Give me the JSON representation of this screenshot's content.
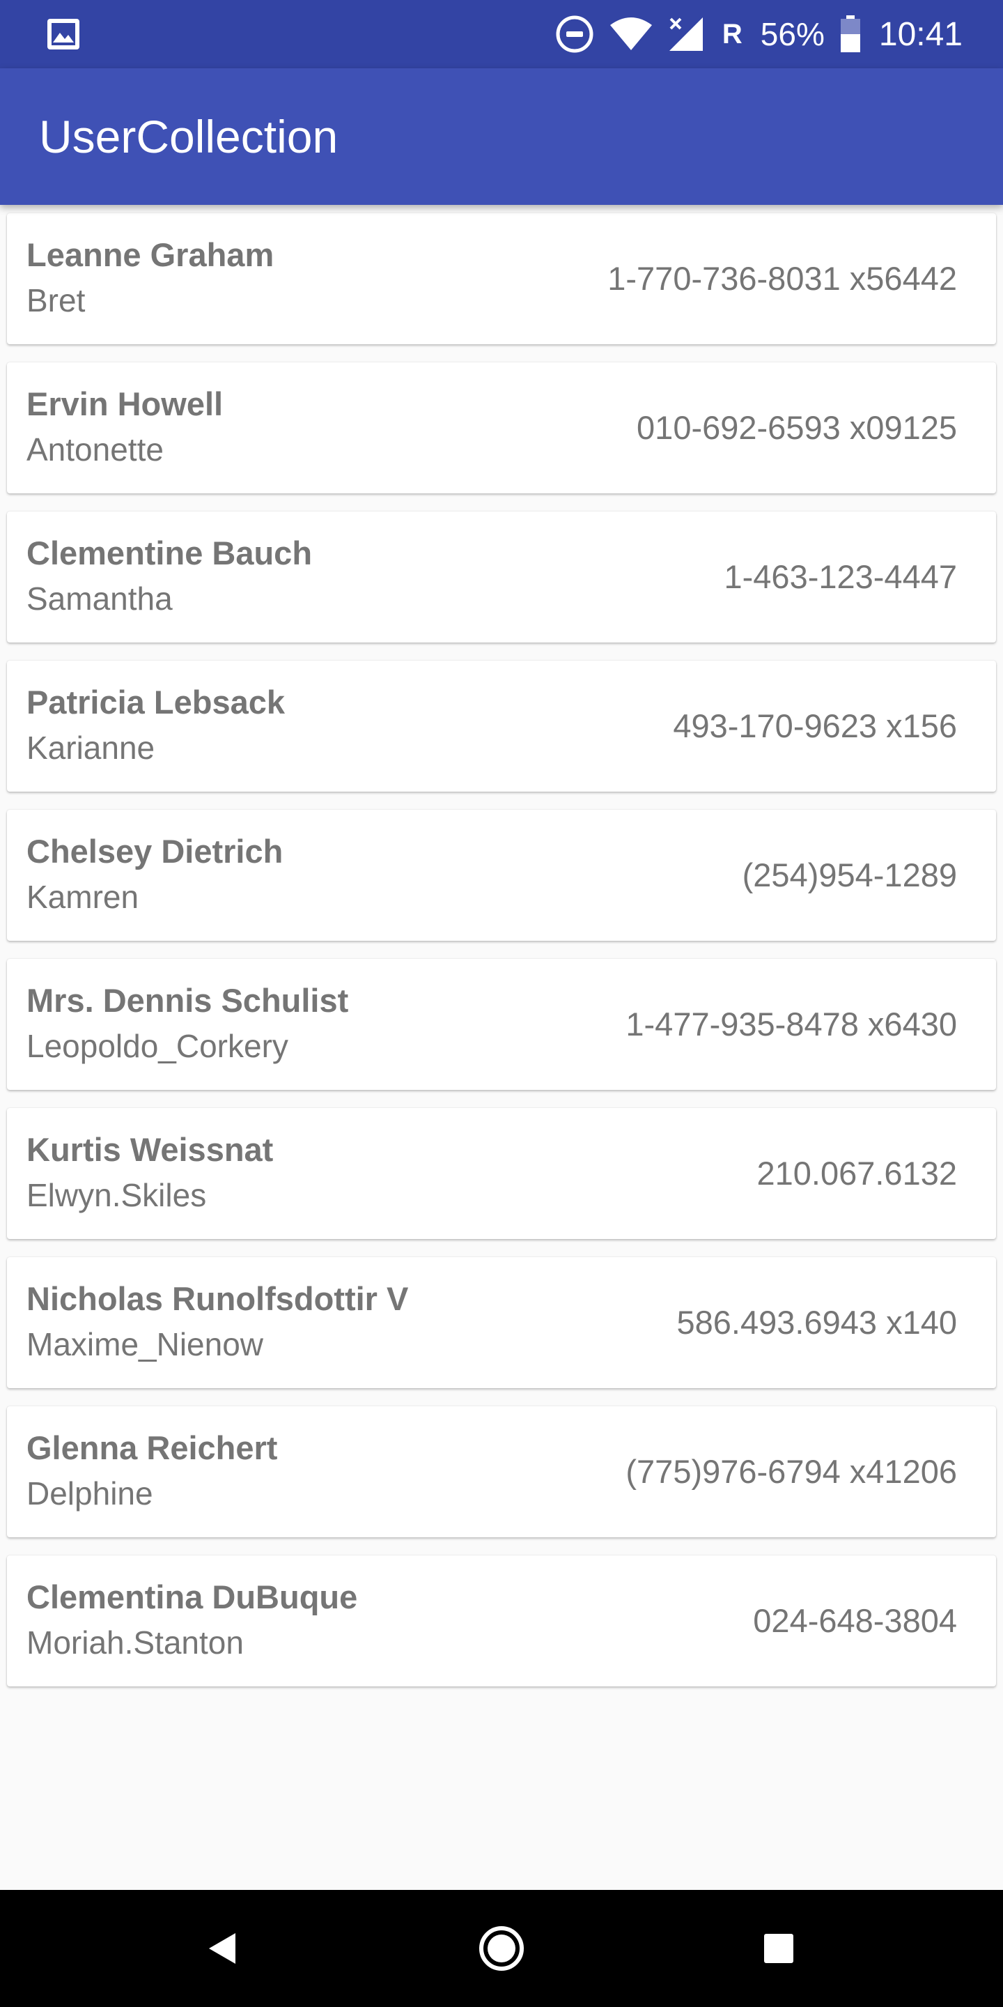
{
  "status_bar": {
    "left_icon": "image-icon",
    "icons": [
      "do-not-disturb-icon",
      "wifi-icon",
      "signal-icon"
    ],
    "roaming": "R",
    "battery_percent": "56%",
    "battery_icon": "battery-icon",
    "time": "10:41",
    "color": "#3344a4"
  },
  "app_bar": {
    "title": "UserCollection",
    "color": "#3f51b5"
  },
  "users": [
    {
      "name": "Leanne Graham",
      "username": "Bret",
      "phone": "1-770-736-8031 x56442"
    },
    {
      "name": "Ervin Howell",
      "username": "Antonette",
      "phone": "010-692-6593 x09125"
    },
    {
      "name": "Clementine Bauch",
      "username": "Samantha",
      "phone": "1-463-123-4447"
    },
    {
      "name": "Patricia Lebsack",
      "username": "Karianne",
      "phone": "493-170-9623 x156"
    },
    {
      "name": "Chelsey Dietrich",
      "username": "Kamren",
      "phone": "(254)954-1289"
    },
    {
      "name": "Mrs. Dennis Schulist",
      "username": "Leopoldo_Corkery",
      "phone": "1-477-935-8478 x6430"
    },
    {
      "name": "Kurtis Weissnat",
      "username": "Elwyn.Skiles",
      "phone": "210.067.6132"
    },
    {
      "name": "Nicholas Runolfsdottir V",
      "username": "Maxime_Nienow",
      "phone": "586.493.6943 x140"
    },
    {
      "name": "Glenna Reichert",
      "username": "Delphine",
      "phone": "(775)976-6794 x41206"
    },
    {
      "name": "Clementina DuBuque",
      "username": "Moriah.Stanton",
      "phone": "024-648-3804"
    }
  ],
  "nav_bar": {
    "back": "back-icon",
    "home": "home-icon",
    "recents": "recents-icon"
  }
}
